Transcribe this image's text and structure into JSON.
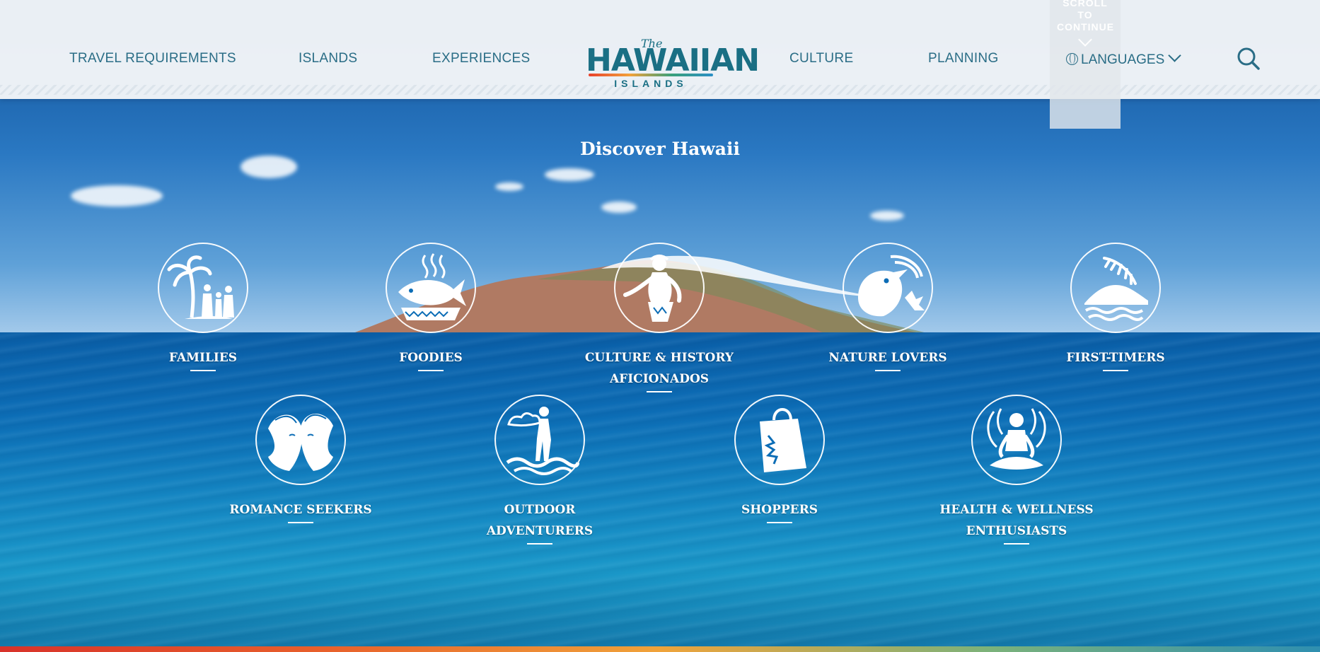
{
  "header": {
    "nav_left": [
      "TRAVEL REQUIREMENTS",
      "ISLANDS",
      "EXPERIENCES"
    ],
    "nav_right": [
      "CULTURE",
      "PLANNING"
    ],
    "logo": {
      "the": "The",
      "main": "HAWAIIAN",
      "sub": "ISLANDS"
    },
    "languages_label": "LANGUAGES",
    "scroll_hint": "SCROLL TO CONTINUE",
    "search_icon": "search-icon"
  },
  "main": {
    "title": "Discover Hawaii",
    "categories_row1": [
      {
        "label": "FAMILIES",
        "icon": "family-palm-icon"
      },
      {
        "label": "FOODIES",
        "icon": "fish-dish-icon"
      },
      {
        "label": "CULTURE & HISTORY AFICIONADOS",
        "icon": "hula-dancer-icon"
      },
      {
        "label": "NATURE LOVERS",
        "icon": "bird-icon"
      },
      {
        "label": "FIRST-TIMERS",
        "icon": "diamond-head-icon"
      }
    ],
    "categories_row2": [
      {
        "label": "ROMANCE SEEKERS",
        "icon": "couple-icon"
      },
      {
        "label": "OUTDOOR ADVENTURERS",
        "icon": "paddleboard-icon"
      },
      {
        "label": "SHOPPERS",
        "icon": "shopping-bag-icon"
      },
      {
        "label": "HEALTH & WELLNESS ENTHUSIASTS",
        "icon": "meditation-icon"
      }
    ]
  },
  "colors": {
    "nav_text": "#2a6d86",
    "header_bg": "#f4f6f8",
    "accent_gradient": [
      "#d8322a",
      "#f0a33a",
      "#2f8fb0"
    ]
  }
}
